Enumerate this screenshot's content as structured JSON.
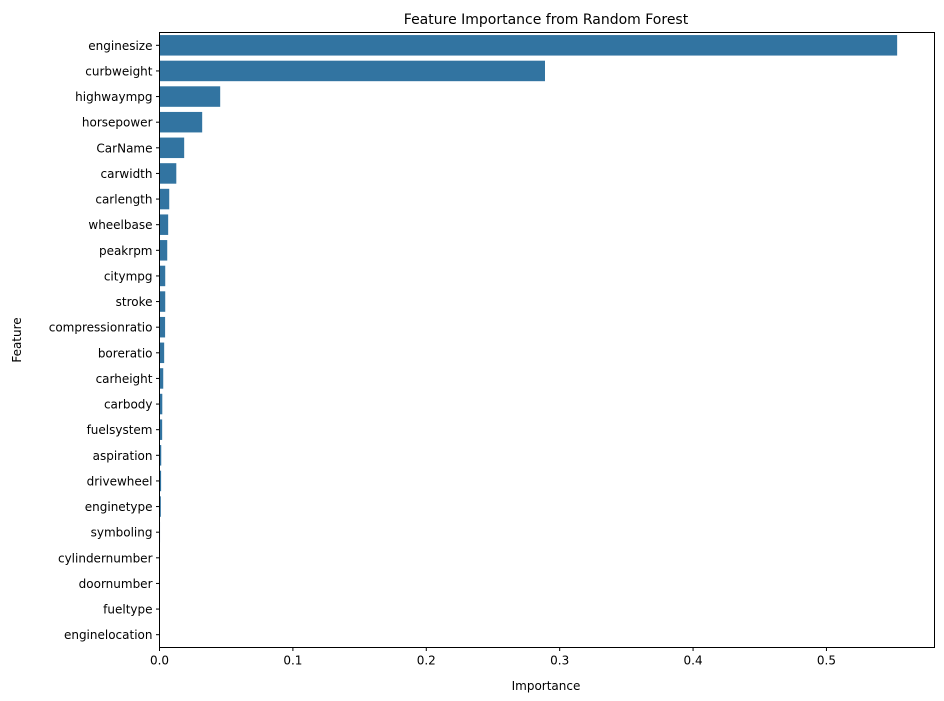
{
  "chart_data": {
    "type": "bar",
    "orientation": "horizontal",
    "title": "Feature Importance from Random Forest",
    "xlabel": "Importance",
    "ylabel": "Feature",
    "xlim": [
      0,
      0.581
    ],
    "xticks": [
      0.0,
      0.1,
      0.2,
      0.3,
      0.4,
      0.5
    ],
    "xtick_labels": [
      "0.0",
      "0.1",
      "0.2",
      "0.3",
      "0.4",
      "0.5"
    ],
    "grid": false,
    "bar_color": "#3274a1",
    "categories": [
      "enginesize",
      "curbweight",
      "highwaympg",
      "horsepower",
      "CarName",
      "carwidth",
      "carlength",
      "wheelbase",
      "peakrpm",
      "citympg",
      "stroke",
      "compressionratio",
      "boreratio",
      "carheight",
      "carbody",
      "fuelsystem",
      "aspiration",
      "drivewheel",
      "enginetype",
      "symboling",
      "cylindernumber",
      "doornumber",
      "fueltype",
      "enginelocation"
    ],
    "values": [
      0.553,
      0.289,
      0.0455,
      0.032,
      0.0185,
      0.0126,
      0.0073,
      0.0065,
      0.0058,
      0.0043,
      0.0043,
      0.0042,
      0.0035,
      0.0028,
      0.0021,
      0.002,
      0.0013,
      0.0012,
      0.001,
      0.0004,
      0.0003,
      0.0002,
      0.0001,
      0.0
    ]
  }
}
